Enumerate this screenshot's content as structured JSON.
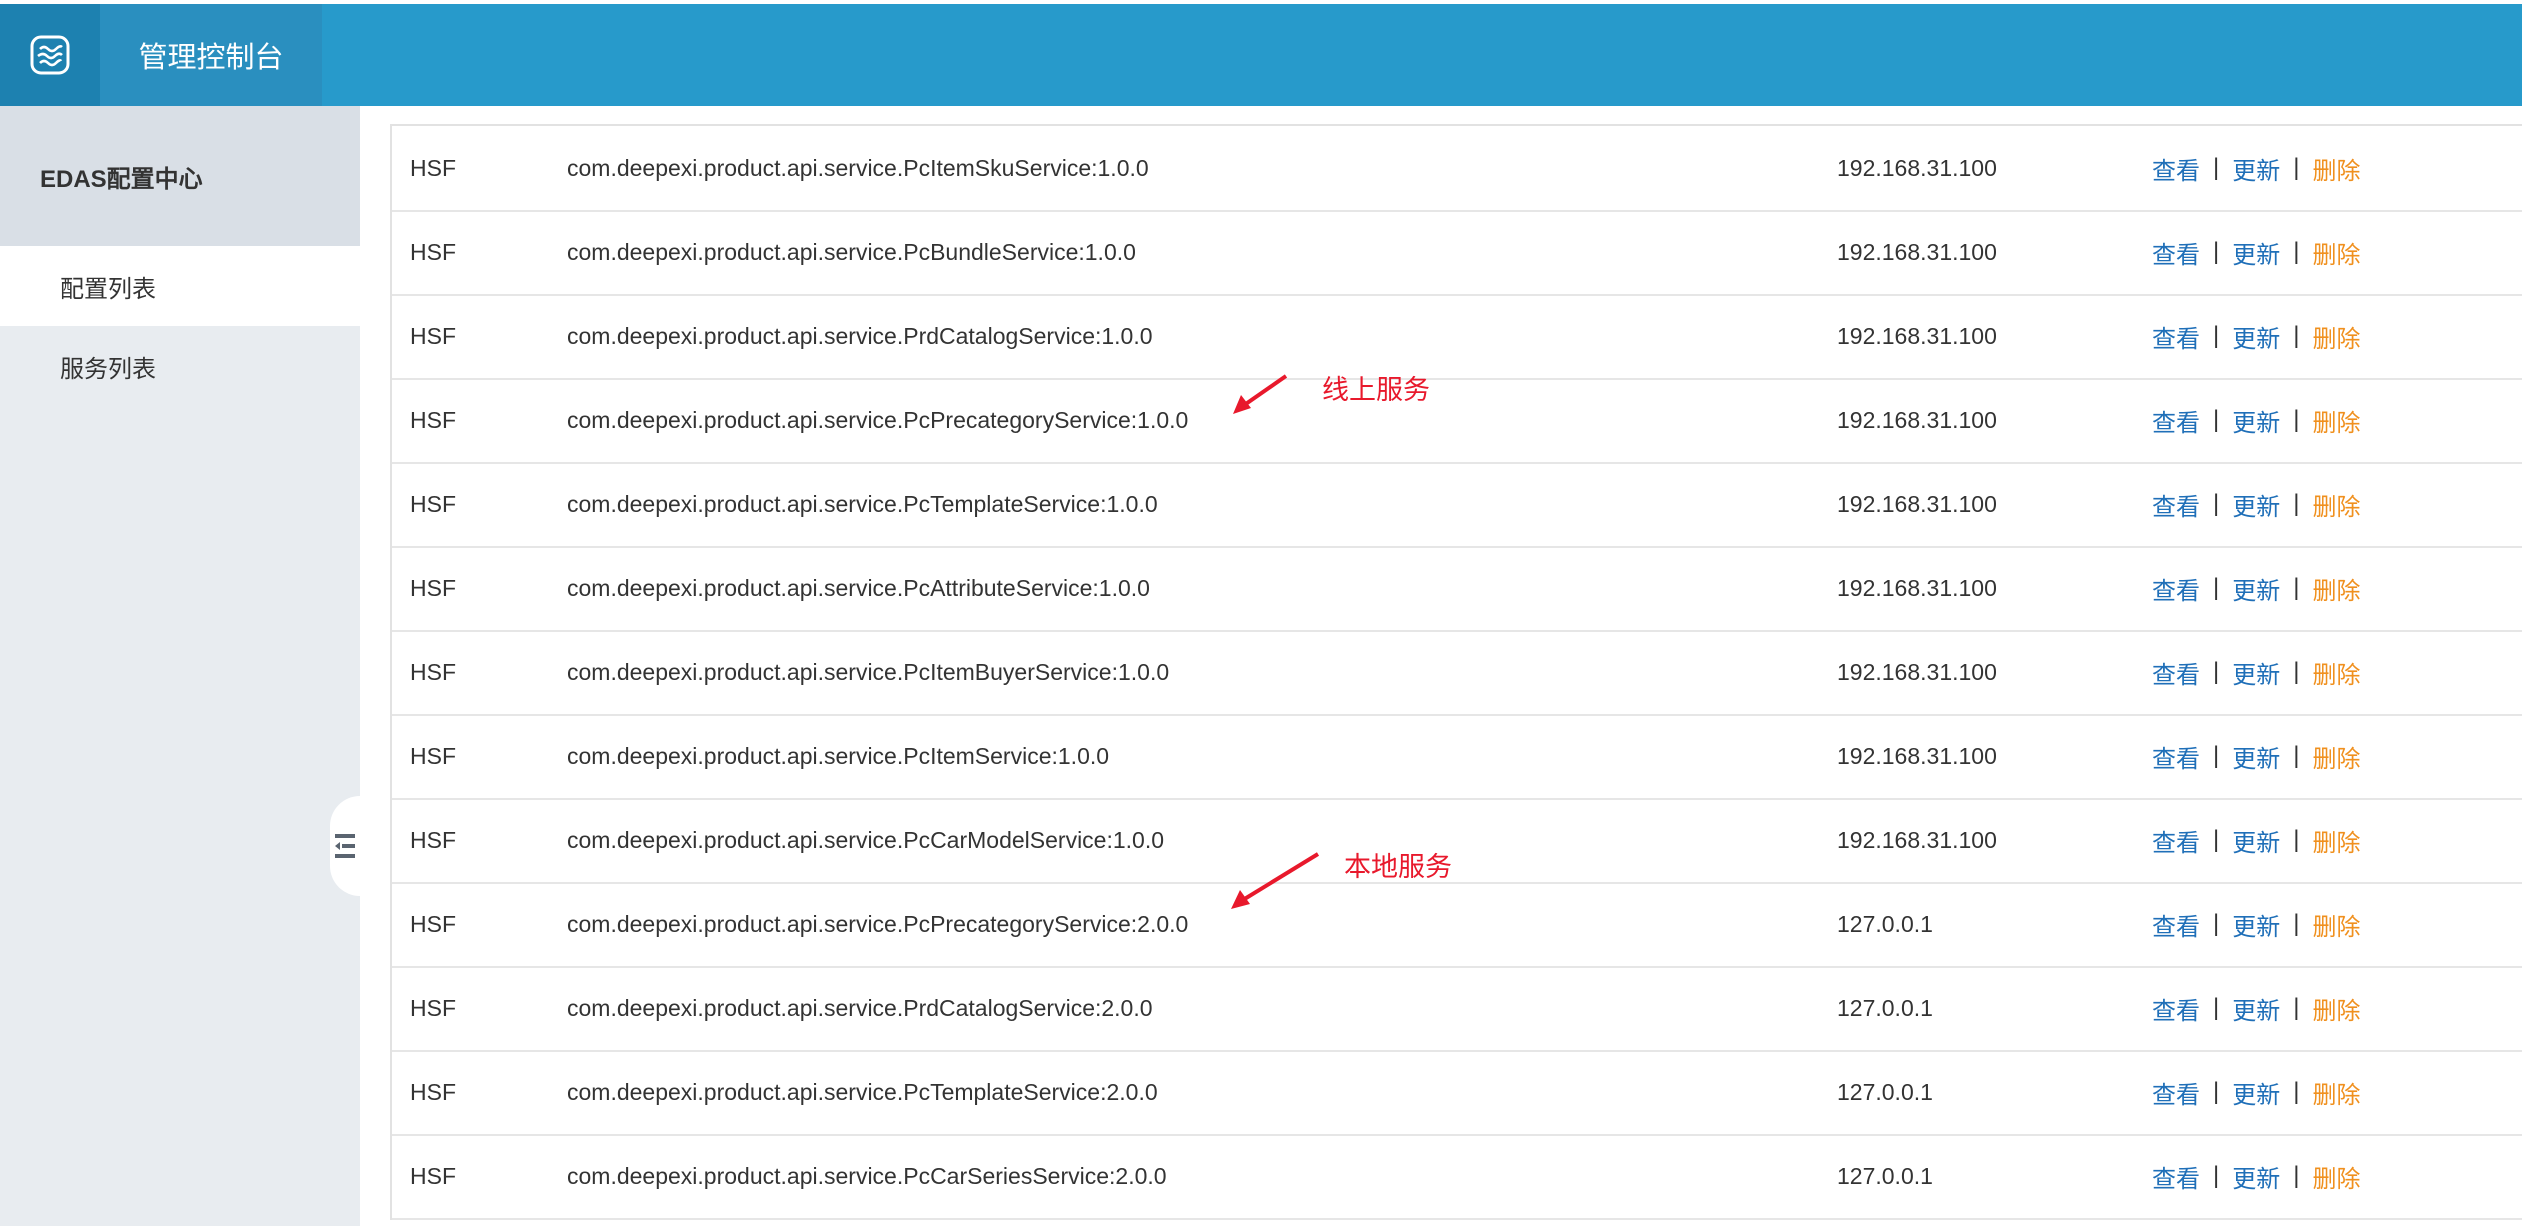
{
  "header": {
    "title": "管理控制台",
    "brand_color": "#279acb"
  },
  "sidebar": {
    "section_title": "EDAS配置中心",
    "items": [
      {
        "label": "配置列表",
        "active": true
      },
      {
        "label": "服务列表",
        "active": false
      }
    ]
  },
  "table": {
    "rows": [
      {
        "type": "HSF",
        "name": "com.deepexi.product.api.service.PcItemSkuService:1.0.0",
        "ip": "192.168.31.100"
      },
      {
        "type": "HSF",
        "name": "com.deepexi.product.api.service.PcBundleService:1.0.0",
        "ip": "192.168.31.100"
      },
      {
        "type": "HSF",
        "name": "com.deepexi.product.api.service.PrdCatalogService:1.0.0",
        "ip": "192.168.31.100"
      },
      {
        "type": "HSF",
        "name": "com.deepexi.product.api.service.PcPrecategoryService:1.0.0",
        "ip": "192.168.31.100"
      },
      {
        "type": "HSF",
        "name": "com.deepexi.product.api.service.PcTemplateService:1.0.0",
        "ip": "192.168.31.100"
      },
      {
        "type": "HSF",
        "name": "com.deepexi.product.api.service.PcAttributeService:1.0.0",
        "ip": "192.168.31.100"
      },
      {
        "type": "HSF",
        "name": "com.deepexi.product.api.service.PcItemBuyerService:1.0.0",
        "ip": "192.168.31.100"
      },
      {
        "type": "HSF",
        "name": "com.deepexi.product.api.service.PcItemService:1.0.0",
        "ip": "192.168.31.100"
      },
      {
        "type": "HSF",
        "name": "com.deepexi.product.api.service.PcCarModelService:1.0.0",
        "ip": "192.168.31.100"
      },
      {
        "type": "HSF",
        "name": "com.deepexi.product.api.service.PcPrecategoryService:2.0.0",
        "ip": "127.0.0.1"
      },
      {
        "type": "HSF",
        "name": "com.deepexi.product.api.service.PrdCatalogService:2.0.0",
        "ip": "127.0.0.1"
      },
      {
        "type": "HSF",
        "name": "com.deepexi.product.api.service.PcTemplateService:2.0.0",
        "ip": "127.0.0.1"
      },
      {
        "type": "HSF",
        "name": "com.deepexi.product.api.service.PcCarSeriesService:2.0.0",
        "ip": "127.0.0.1"
      }
    ],
    "actions": {
      "view": "查看",
      "update": "更新",
      "delete": "删除",
      "separator": "|"
    }
  },
  "annotations": {
    "online": "线上服务",
    "local": "本地服务",
    "color": "#e8192c"
  },
  "icons": {
    "logo": "console-logo-icon",
    "collapse": "collapse-sidebar-icon"
  }
}
